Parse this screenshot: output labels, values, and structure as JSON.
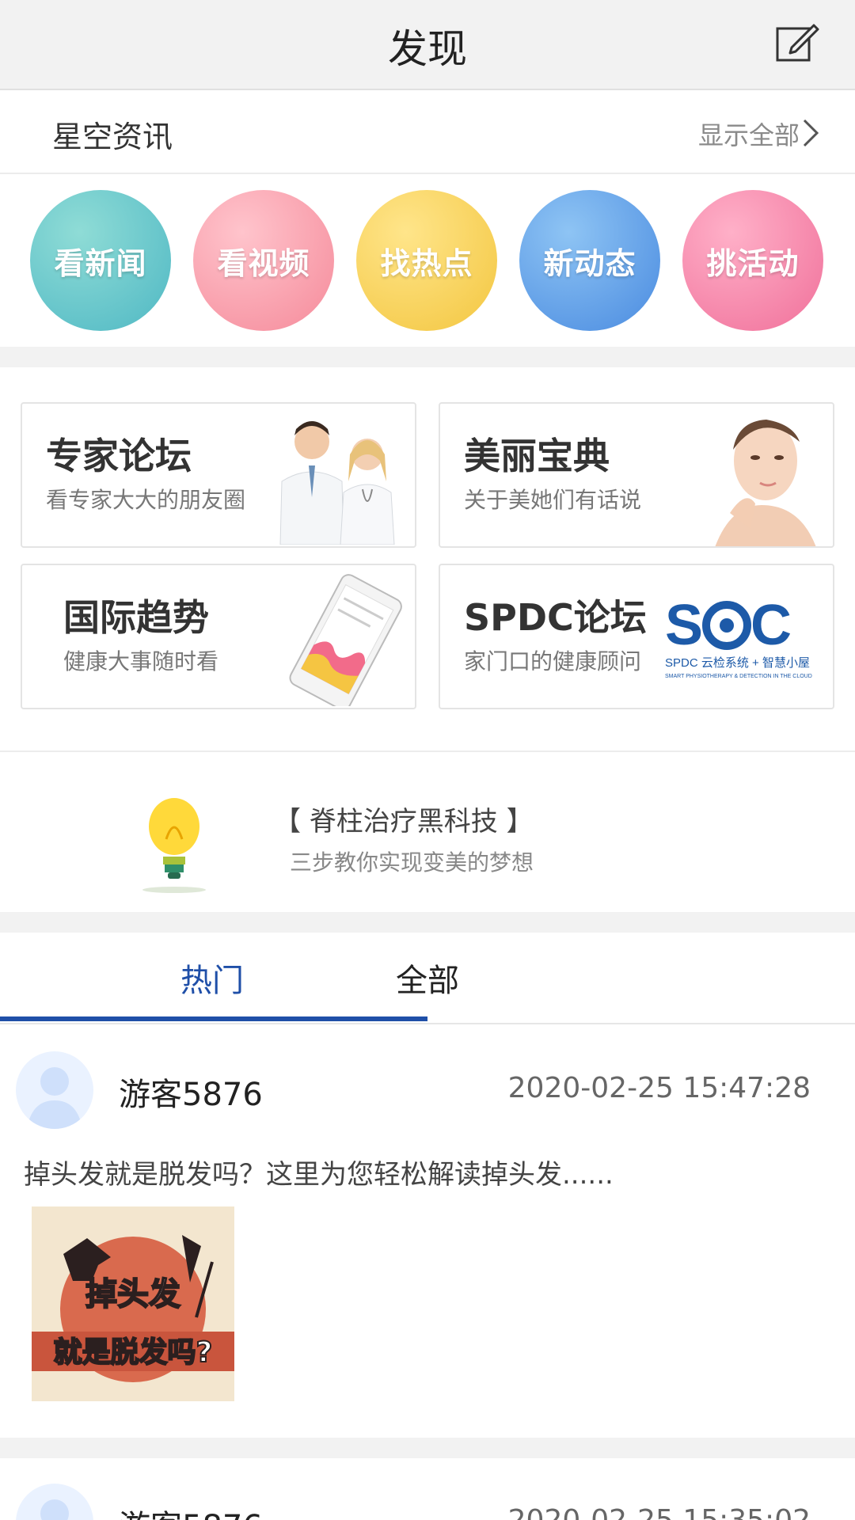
{
  "header": {
    "title": "发现"
  },
  "news": {
    "label": "星空资讯",
    "more": "显示全部"
  },
  "circles": [
    "看新闻",
    "看视频",
    "找热点",
    "新动态",
    "挑活动"
  ],
  "cards": [
    {
      "title": "专家论坛",
      "subtitle": "看专家大大的朋友圈"
    },
    {
      "title": "美丽宝典",
      "subtitle": "关于美她们有话说"
    },
    {
      "title": "国际趋势",
      "subtitle": "健康大事随时看"
    },
    {
      "title": "SPDC论坛",
      "subtitle": "家门口的健康顾问",
      "logo_text": "SPDC 云检系统 + 智慧小屋",
      "logo_small": "SMART PHYSIOTHERAPY & DETECTION IN THE CLOUD"
    }
  ],
  "promo": {
    "title": "【 脊柱治疗黑科技 】",
    "subtitle": "三步教你实现变美的梦想"
  },
  "tabs": {
    "hot": "热门",
    "all": "全部"
  },
  "posts": [
    {
      "user": "游客5876",
      "time": "2020-02-25 15:47:28",
      "text": "掉头发就是脱发吗？这里为您轻松解读掉头发......",
      "image_text_1": "掉头发",
      "image_text_2": "就是脱发吗?"
    },
    {
      "user": "游客5876",
      "time": "2020-02-25 15:35:02"
    }
  ],
  "colors": {
    "accent": "#1f4fa8"
  }
}
